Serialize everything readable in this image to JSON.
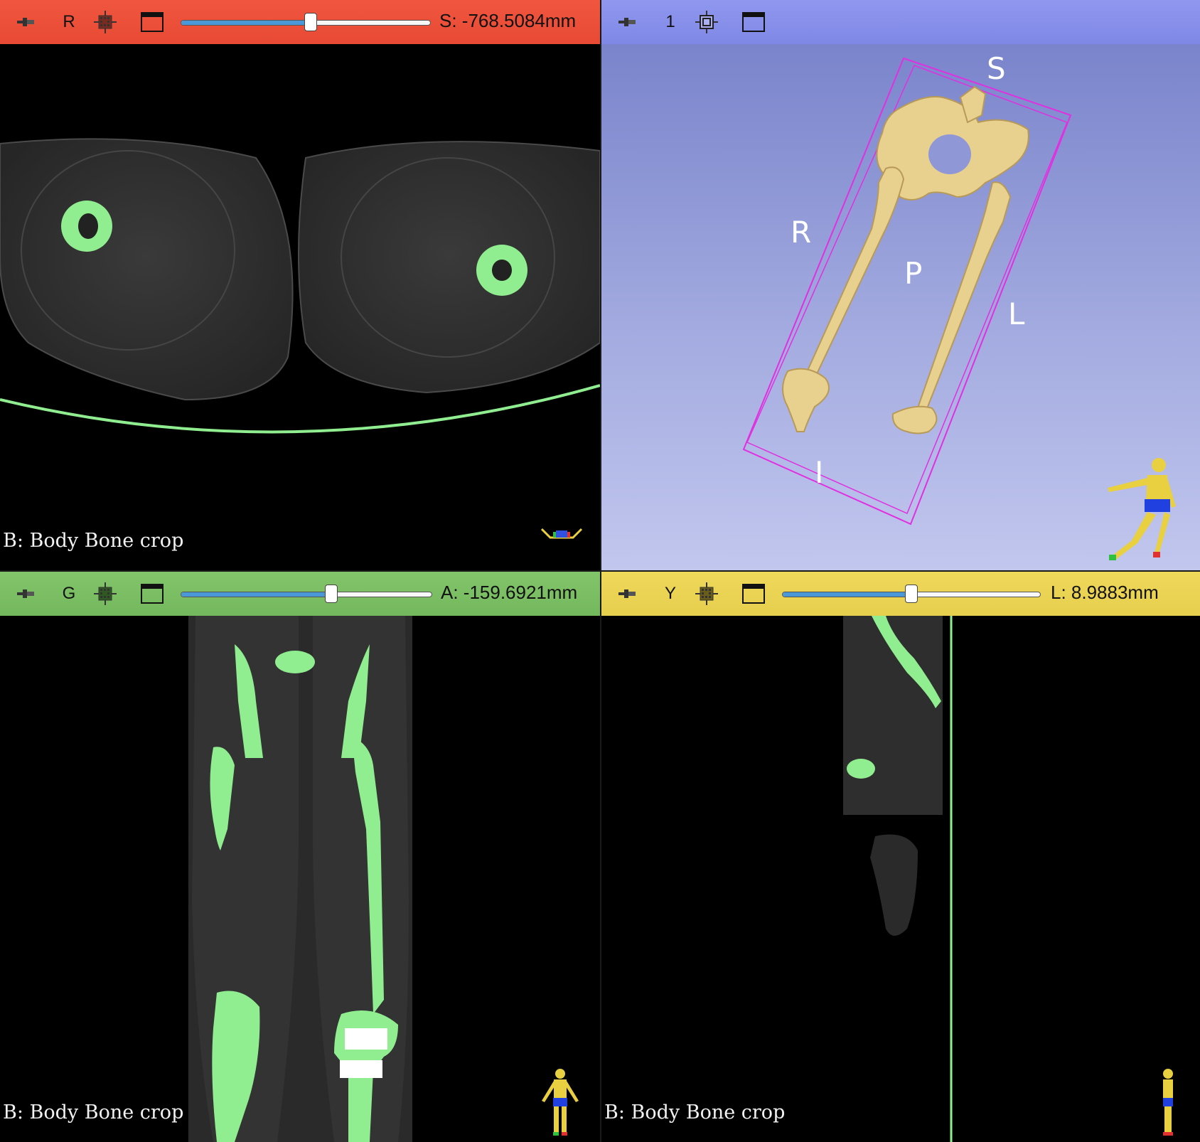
{
  "views": {
    "red": {
      "label": "R",
      "offset": "S: -768.5084mm",
      "slider_fraction": 0.52,
      "segmentation": "B: Body Bone crop",
      "color": "#e84a34"
    },
    "threeD": {
      "label": "1",
      "orientation": {
        "S": "S",
        "R": "R",
        "P": "P",
        "L": "L",
        "I": "I"
      },
      "color": "#7f88e6"
    },
    "green": {
      "label": "G",
      "offset": "A: -159.6921mm",
      "slider_fraction": 0.6,
      "segmentation": "B: Body Bone crop",
      "color": "#74b85d"
    },
    "yellow": {
      "label": "Y",
      "offset": "L: 8.9883mm",
      "slider_fraction": 0.5,
      "segmentation": "B: Body Bone crop",
      "color": "#e6cf4d"
    }
  },
  "icons": [
    "pin-icon",
    "link-icon",
    "maximize-icon",
    "orientation-marker-icon"
  ],
  "colors": {
    "segment": "#90ee90",
    "bone3d": "#e8d08f",
    "roi_box": "#e030e0"
  }
}
